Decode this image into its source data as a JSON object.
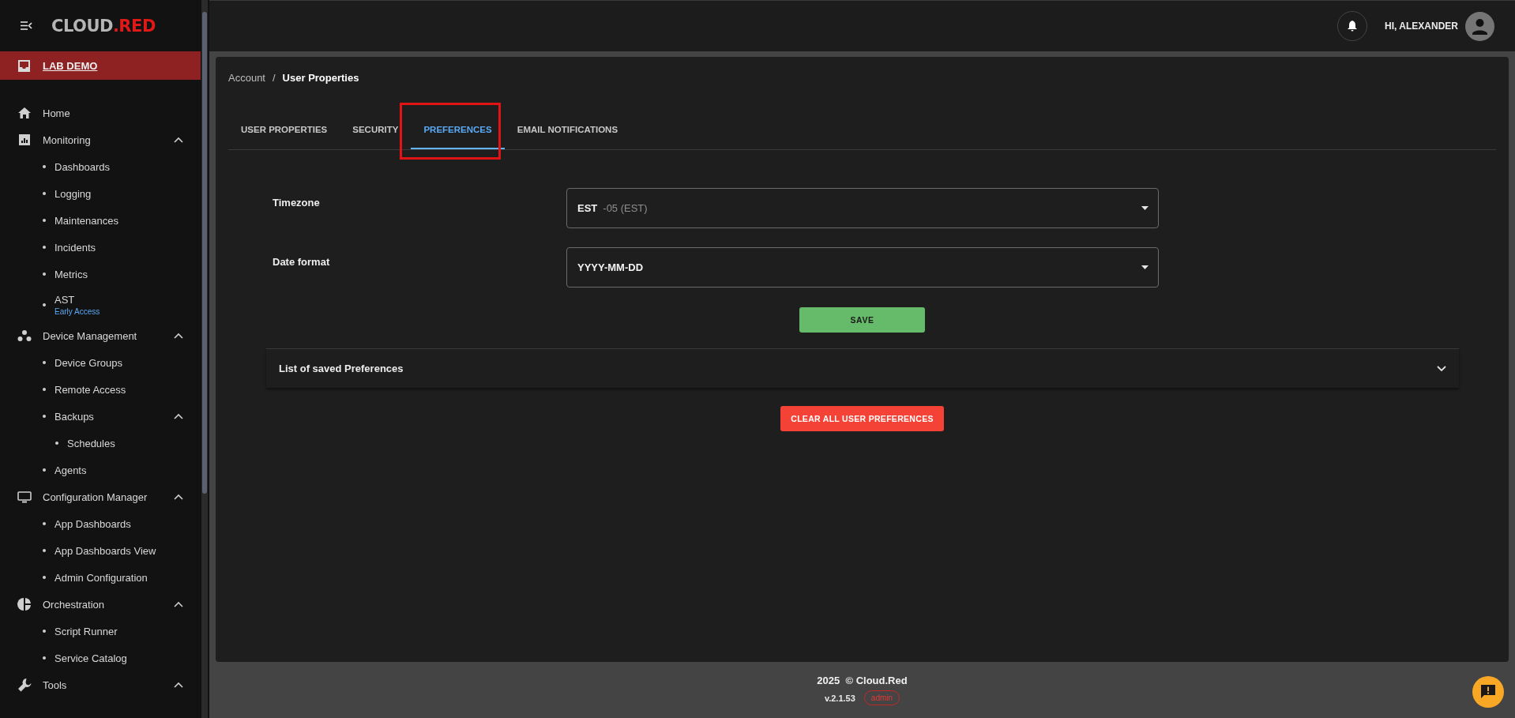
{
  "header": {
    "logo": {
      "word": "CLOUD",
      "suffix": ".RED"
    },
    "greeting": "HI, ALEXANDER"
  },
  "sidebar": {
    "workspace": "LAB DEMO",
    "items": [
      {
        "label": "Home"
      },
      {
        "label": "Monitoring",
        "expanded": true,
        "children": [
          {
            "label": "Dashboards"
          },
          {
            "label": "Logging"
          },
          {
            "label": "Maintenances"
          },
          {
            "label": "Incidents"
          },
          {
            "label": "Metrics"
          },
          {
            "label": "AST",
            "note": "Early Access"
          }
        ]
      },
      {
        "label": "Device Management",
        "expanded": true,
        "children": [
          {
            "label": "Device Groups"
          },
          {
            "label": "Remote Access"
          },
          {
            "label": "Backups",
            "expanded": true,
            "children": [
              {
                "label": "Schedules"
              }
            ]
          },
          {
            "label": "Agents"
          }
        ]
      },
      {
        "label": "Configuration Manager",
        "expanded": true,
        "children": [
          {
            "label": "App Dashboards"
          },
          {
            "label": "App Dashboards View"
          },
          {
            "label": "Admin Configuration"
          }
        ]
      },
      {
        "label": "Orchestration",
        "expanded": true,
        "children": [
          {
            "label": "Script Runner"
          },
          {
            "label": "Service Catalog"
          }
        ]
      },
      {
        "label": "Tools",
        "expanded": true
      }
    ]
  },
  "breadcrumb": [
    "Account",
    "User Properties"
  ],
  "breadcrumb_separator": "/",
  "tabs": [
    {
      "label": "USER PROPERTIES",
      "selected": false
    },
    {
      "label": "SECURITY",
      "selected": false
    },
    {
      "label": "PREFERENCES",
      "selected": true
    },
    {
      "label": "EMAIL NOTIFICATIONS",
      "selected": false
    }
  ],
  "form": {
    "fields": [
      {
        "label": "Timezone",
        "value": "EST",
        "hint": "-05 (EST)"
      },
      {
        "label": "Date format",
        "value": "YYYY-MM-DD"
      }
    ],
    "save_button": "SAVE"
  },
  "accordion": {
    "title": "List of saved Preferences",
    "expanded": false
  },
  "clear_button": "CLEAR ALL USER PREFERENCES",
  "footer": {
    "copyright": "2025  © Cloud.Red",
    "version": "v.2.1.53",
    "role": "admin"
  }
}
